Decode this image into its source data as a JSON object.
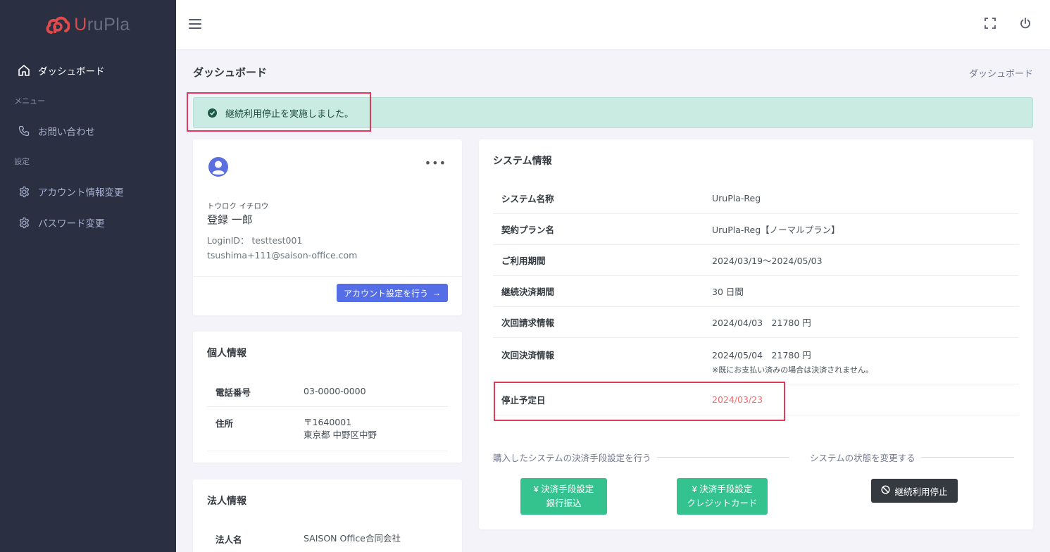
{
  "app": {
    "logo_text_accent": "U",
    "logo_text_rest": "ruPla",
    "brand_color": "#e04a4a"
  },
  "sidebar": {
    "items": [
      {
        "label": "ダッシュボード",
        "icon": "home-icon",
        "active": true
      },
      {
        "section": "メニュー"
      },
      {
        "label": "お問い合わせ",
        "icon": "phone-icon"
      },
      {
        "section": "設定"
      },
      {
        "label": "アカウント情報変更",
        "icon": "gear-icon"
      },
      {
        "label": "パスワード変更",
        "icon": "gear-icon"
      }
    ]
  },
  "topbar": {
    "icons": [
      "hamburger-icon",
      "fullscreen-icon",
      "power-icon"
    ]
  },
  "page": {
    "title": "ダッシュボード",
    "breadcrumb": "ダッシュボード"
  },
  "alert": {
    "message": "継続利用停止を実施しました。"
  },
  "user": {
    "kana": "トウロク イチロウ",
    "name": "登録 一郎",
    "login_label": "LoginID：",
    "login_id": "testtest001",
    "email": "tsushima+111@saison-office.com",
    "button": "アカウント設定を行う"
  },
  "personal": {
    "title": "個人情報",
    "rows": [
      {
        "key": "電話番号",
        "value": "03-0000-0000"
      },
      {
        "key": "住所",
        "value": "〒1640001",
        "value2": "東京都 中野区中野"
      }
    ]
  },
  "corp": {
    "title": "法人情報",
    "rows": [
      {
        "key": "法人名",
        "value": "SAISON Office合同会社"
      }
    ]
  },
  "system": {
    "title": "システム情報",
    "rows": [
      {
        "key": "システム名称",
        "value": "UruPla-Reg"
      },
      {
        "key": "契約プラン名",
        "value": "UruPla-Reg【ノーマルプラン】"
      },
      {
        "key": "ご利用期間",
        "value": "2024/03/19～2024/05/03"
      },
      {
        "key": "継続決済期間",
        "value": "30 日間"
      },
      {
        "key": "次回請求情報",
        "value": "2024/04/03　21780 円"
      },
      {
        "key": "次回決済情報",
        "value": "2024/05/04　21780 円",
        "note": "※既にお支払い済みの場合は決済されません。"
      },
      {
        "key": "停止予定日",
        "value": "2024/03/23"
      }
    ],
    "payment_section": "購入したシステムの決済手段設定を行う",
    "status_section": "システムの状態を変更する",
    "btn_bank_line1": "¥ 決済手段設定",
    "btn_bank_line2": "銀行振込",
    "btn_card_line1": "¥ 決済手段設定",
    "btn_card_line2": "クレジットカード",
    "btn_stop": "継続利用停止"
  }
}
